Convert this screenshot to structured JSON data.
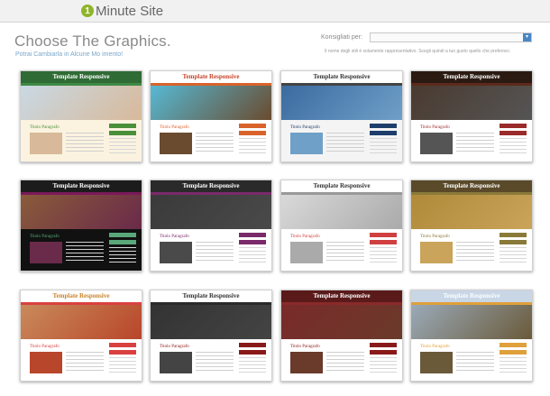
{
  "header": {
    "logo_mark": "1",
    "logo_text": "Minute Site"
  },
  "main": {
    "title": "Choose The Graphics.",
    "subtitle": "Potrai Cambiarla in Alcune Mo  imento!",
    "select_label": "Konsigliati per:",
    "hint": "Il nome degli stili è solamente rappresentativo. Scegli quindi a tuo gusto quello che preferisci."
  },
  "cards": [
    {
      "title": "Template Responsive",
      "page_title": "Titolo Paragrafo",
      "hdr_bg": "#2f6b35",
      "hdr_fg": "#ffffff",
      "nav": "#3e8a45",
      "hero": "#c9d9e4",
      "body_bg": "#fbf3e0",
      "img": "#d8b99a",
      "accent": "#4a8f3a",
      "side": "#fbf3e0"
    },
    {
      "title": "Template Responsive",
      "page_title": "Titolo Paragrafo",
      "hdr_bg": "#ffffff",
      "hdr_fg": "#c9422a",
      "nav": "#d9632b",
      "hero": "#56b9d4",
      "body_bg": "#ffffff",
      "img": "#6a4b2f",
      "accent": "#d9632b",
      "side": "#ffffff"
    },
    {
      "title": "Template Responsive",
      "page_title": "Titolo Paragrafo",
      "hdr_bg": "#ffffff",
      "hdr_fg": "#333333",
      "nav": "#444444",
      "hero": "#3b6aa0",
      "body_bg": "#f4f4f4",
      "img": "#6fa0c8",
      "accent": "#1d3e6b",
      "side": "#f4f4f4"
    },
    {
      "title": "Template Responsive",
      "page_title": "Titolo Paragrafo",
      "hdr_bg": "#2b1a12",
      "hdr_fg": "#ffffff",
      "nav": "#5c2a1c",
      "hero": "#4a3a30",
      "body_bg": "#ffffff",
      "img": "#555555",
      "accent": "#9b2a2a",
      "side": "#ffffff"
    },
    {
      "title": "Template Responsive",
      "page_title": "Titolo Paragrafo",
      "hdr_bg": "#1c1c1c",
      "hdr_fg": "#ffffff",
      "nav": "#7a1a5a",
      "hero": "#8a5b3a",
      "body_bg": "#111111",
      "img": "#6a2a4a",
      "accent": "#5aa87a",
      "side": "#111111"
    },
    {
      "title": "Template Responsive",
      "page_title": "Titolo Paragrafo",
      "hdr_bg": "#2a2a2a",
      "hdr_fg": "#ffffff",
      "nav": "#7a2a6a",
      "hero": "#3a3a3a",
      "body_bg": "#ffffff",
      "img": "#4a4a4a",
      "accent": "#7a2a6a",
      "side": "#ffffff"
    },
    {
      "title": "Template Responsive",
      "page_title": "Titolo Paragrafo",
      "hdr_bg": "#ffffff",
      "hdr_fg": "#333333",
      "nav": "#999999",
      "hero": "#d9d9d9",
      "body_bg": "#ffffff",
      "img": "#aaaaaa",
      "accent": "#d04040",
      "side": "#ffffff"
    },
    {
      "title": "Template Responsive",
      "page_title": "Titolo Paragrafo",
      "hdr_bg": "#5a4a2a",
      "hdr_fg": "#ffffff",
      "nav": "#8a7a3a",
      "hero": "#b08a3a",
      "body_bg": "#ffffff",
      "img": "#c9a45a",
      "accent": "#8a7a3a",
      "side": "#ffffff"
    },
    {
      "title": "Template Responsive",
      "page_title": "Titolo Paragrafo",
      "hdr_bg": "#ffffff",
      "hdr_fg": "#c9832a",
      "nav": "#d94040",
      "hero": "#c98a5a",
      "body_bg": "#ffffff",
      "img": "#b8462a",
      "accent": "#d94040",
      "side": "#ffffff"
    },
    {
      "title": "Template Responsive",
      "page_title": "Titolo Paragrafo",
      "hdr_bg": "#ffffff",
      "hdr_fg": "#333333",
      "nav": "#2a2a2a",
      "hero": "#333333",
      "body_bg": "#ffffff",
      "img": "#444444",
      "accent": "#8a1a1a",
      "side": "#ffffff"
    },
    {
      "title": "Template Responsive",
      "page_title": "Titolo Paragrafo",
      "hdr_bg": "#5a1a1a",
      "hdr_fg": "#ffffff",
      "nav": "#8a2a2a",
      "hero": "#7a2a2a",
      "body_bg": "#ffffff",
      "img": "#6a3a2a",
      "accent": "#8a1a1a",
      "side": "#ffffff"
    },
    {
      "title": "Template Responsive",
      "page_title": "Titolo Paragrafo",
      "hdr_bg": "#c8d6e6",
      "hdr_fg": "#ffffff",
      "nav": "#e0a03a",
      "hero": "#9aaab8",
      "body_bg": "#ffffff",
      "img": "#6a5a3a",
      "accent": "#e0a03a",
      "side": "#ffffff"
    }
  ]
}
